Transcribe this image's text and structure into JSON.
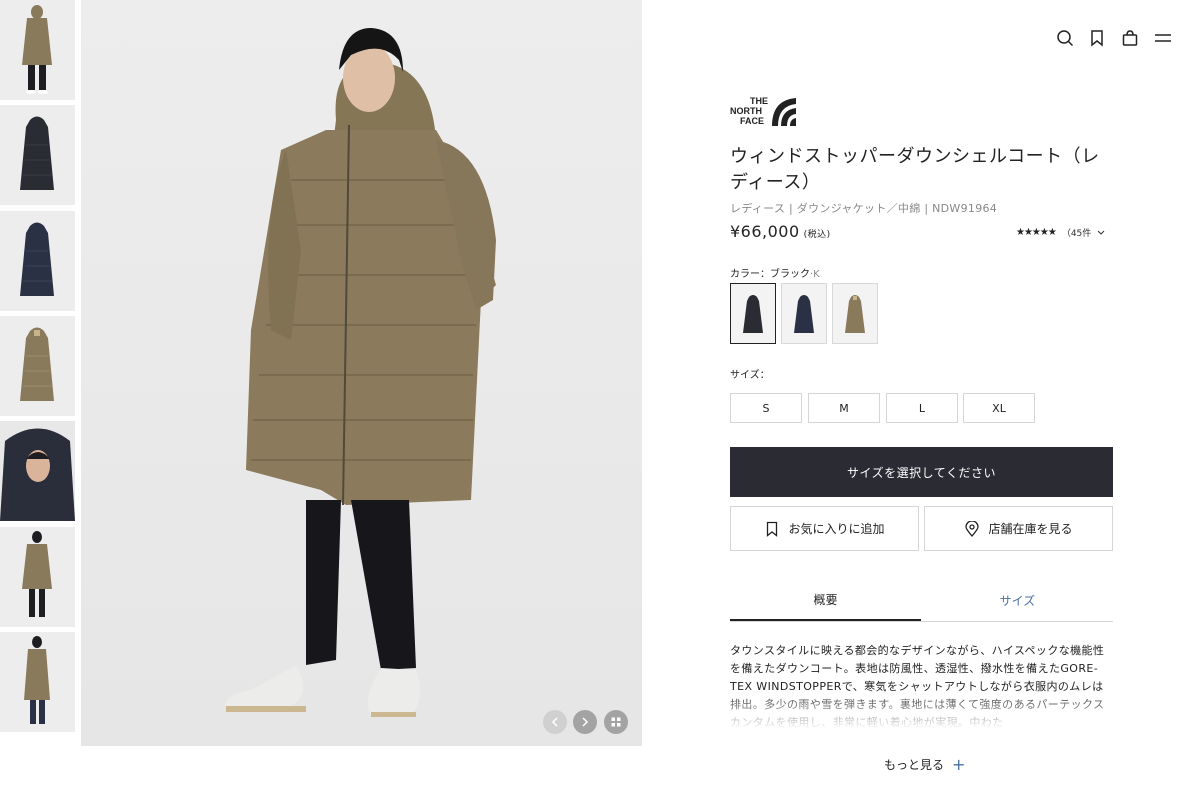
{
  "header": {
    "icons": [
      "search-icon",
      "bookmark-icon",
      "bag-icon",
      "menu-icon"
    ]
  },
  "brand": {
    "logo_line1": "THE",
    "logo_line2": "NORTH",
    "logo_line3": "FACE"
  },
  "product": {
    "title": "ウィンドストッパーダウンシェルコート（レディース）",
    "breadcrumb": "レディース | ダウンジャケット／中綿 | NDW91964",
    "price": "¥66,000",
    "price_note": "(税込)",
    "stars": "★★★★★",
    "review_count": "（45件",
    "color_label": "カラー：",
    "color_value": "ブラック",
    "color_code": "·K",
    "colors": [
      {
        "name": "black",
        "hex": "#2a2c33"
      },
      {
        "name": "navy",
        "hex": "#2b3145"
      },
      {
        "name": "khaki",
        "hex": "#8a7a5c"
      }
    ],
    "size_label": "サイズ：",
    "sizes": [
      "S",
      "M",
      "L",
      "XL"
    ],
    "cta_label": "サイズを選択してください",
    "favorite_label": "お気に入りに追加",
    "store_label": "店舗在庫を見る",
    "tabs": [
      "概要",
      "サイズ"
    ],
    "description": "タウンスタイルに映える都会的なデザインながら、ハイスペックな機能性を備えたダウンコート。表地は防風性、透湿性、撥水性を備えたGORE-TEX WINDSTOPPERで、寒気をシャットアウトしながら衣服内のムレは排出。多少の雨や雪を弾きます。裏地には薄くて強度のあるパーテックスカンタムを使用し、非常に軽い着心地が実現。中わた",
    "more_label": "もっと見る"
  },
  "colors": {
    "coat_khaki": "#8a7a5c",
    "coat_black": "#2a2c33",
    "coat_navy": "#2b3145",
    "cta_bg": "#2b2b33",
    "tab_inactive": "#4a6fa5"
  }
}
